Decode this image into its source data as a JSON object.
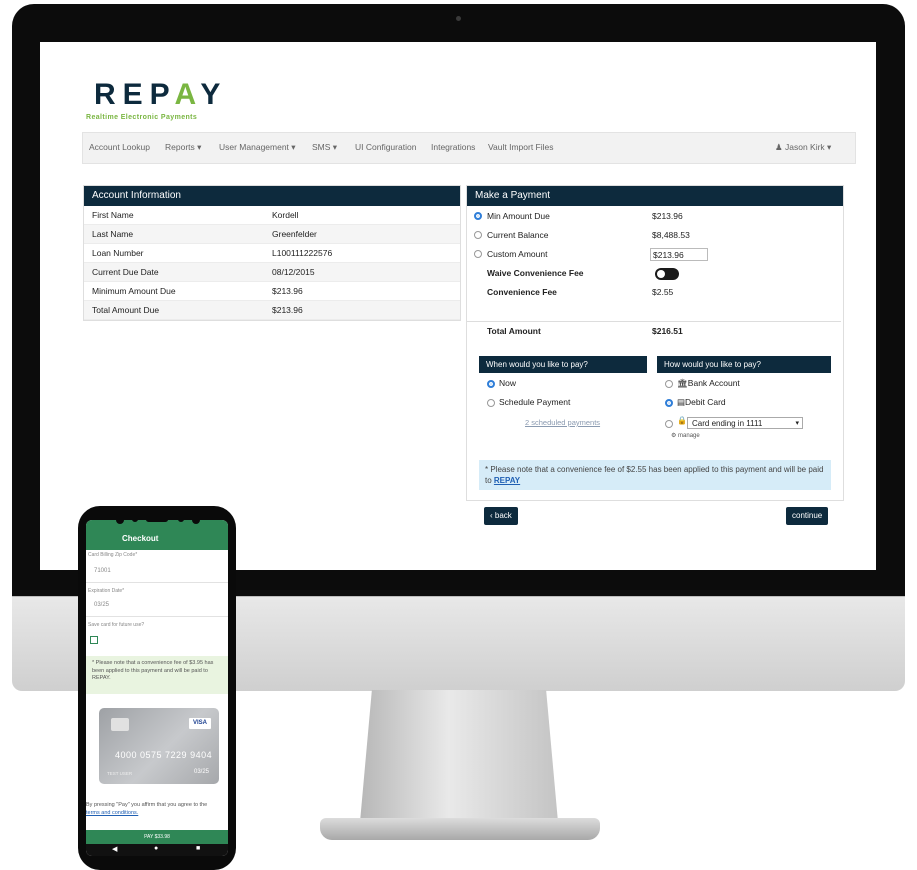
{
  "brand": {
    "logo_left": "REP",
    "logo_accent": "A",
    "logo_right": "Y",
    "tagline": "Realtime Electronic Payments",
    "primary_color": "#0d2a3d",
    "accent_color": "#7ab642"
  },
  "nav": {
    "items": [
      "Account Lookup",
      "Reports ▾",
      "User Management ▾",
      "SMS ▾",
      "UI Configuration",
      "Integrations",
      "Vault Import Files"
    ],
    "user": "Jason Kirk ▾"
  },
  "account_info": {
    "title": "Account Information",
    "rows": [
      {
        "label": "First Name",
        "value": "Kordell"
      },
      {
        "label": "Last Name",
        "value": "Greenfelder"
      },
      {
        "label": "Loan Number",
        "value": "L100111222576"
      },
      {
        "label": "Current Due Date",
        "value": "08/12/2015"
      },
      {
        "label": "Minimum Amount Due",
        "value": "$213.96"
      },
      {
        "label": "Total Amount Due",
        "value": "$213.96"
      }
    ]
  },
  "payment": {
    "title": "Make a Payment",
    "min_due_label": "Min Amount Due",
    "min_due_value": "$213.96",
    "balance_label": "Current Balance",
    "balance_value": "$8,488.53",
    "custom_label": "Custom Amount",
    "custom_value": "$213.96",
    "waive_label": "Waive Convenience Fee",
    "fee_label": "Convenience Fee",
    "fee_value": "$2.55",
    "total_label": "Total Amount",
    "total_value": "$216.51",
    "when_title": "When would you like to pay?",
    "when_now": "Now",
    "when_schedule": "Schedule Payment",
    "scheduled_link": "2 scheduled payments",
    "how_title": "How would you like to pay?",
    "how_bank": "Bank Account",
    "how_debit": "Debit Card",
    "card_select": "Card ending in 1111",
    "manage": "manage",
    "note_text": "* Please note that a convenience fee of $2.55 has been applied to this payment and will be paid to",
    "note_link": "REPAY",
    "back": "‹ back",
    "continue": "continue"
  },
  "phone": {
    "title": "Checkout",
    "zip_label": "Card Billing Zip Code*",
    "zip_value": "71001",
    "exp_label": "Expiration Date*",
    "exp_value": "03/25",
    "save_label": "Save card for future use?",
    "note": "* Please note that a convenience fee of $3.95 has been applied to this payment and will be paid to REPAY.",
    "card_number": "4000 0575 7229 9404",
    "card_holder": "TEST USER",
    "card_exp": "03/25",
    "card_brand": "VISA",
    "terms": "By pressing \"Pay\" you affirm that you agree to the",
    "terms_link": "terms and conditions.",
    "pay_button": "PAY $33.98"
  }
}
